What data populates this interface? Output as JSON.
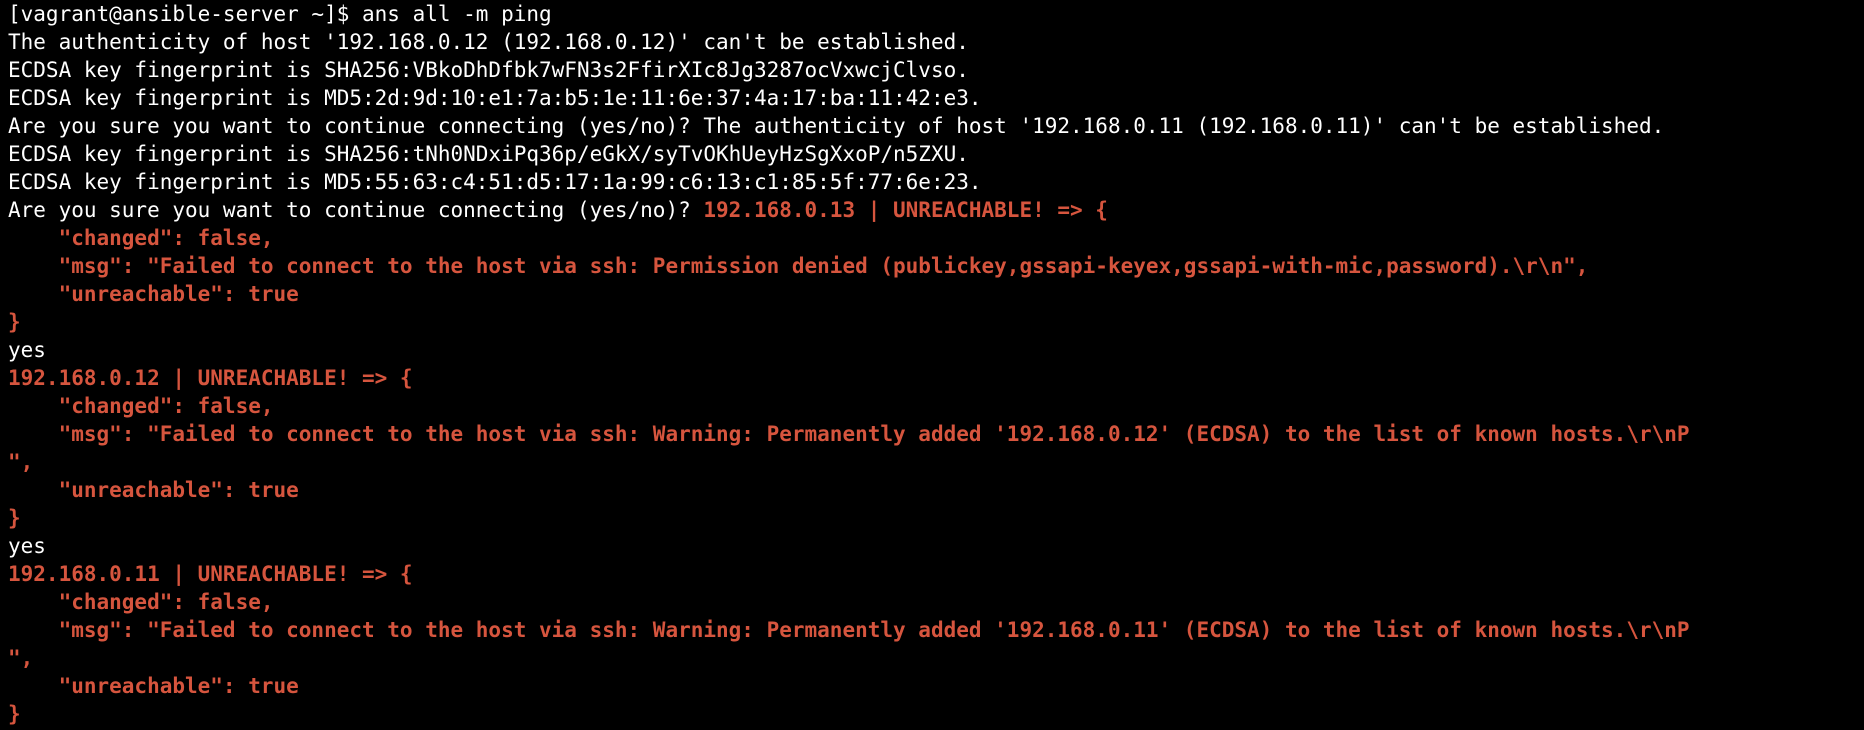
{
  "colors": {
    "background": "#000000",
    "default_text": "#ffffff",
    "error_text": "#d6553e"
  },
  "lines": [
    {
      "segments": [
        {
          "text": "[vagrant@ansible-server ~]$ ans all -m ping",
          "style": "w"
        }
      ]
    },
    {
      "segments": [
        {
          "text": "The authenticity of host '192.168.0.12 (192.168.0.12)' can't be established.",
          "style": "w"
        }
      ]
    },
    {
      "segments": [
        {
          "text": "ECDSA key fingerprint is SHA256:VBkoDhDfbk7wFN3s2FfirXIc8Jg3287ocVxwcjClvso.",
          "style": "w"
        }
      ]
    },
    {
      "segments": [
        {
          "text": "ECDSA key fingerprint is MD5:2d:9d:10:e1:7a:b5:1e:11:6e:37:4a:17:ba:11:42:e3.",
          "style": "w"
        }
      ]
    },
    {
      "segments": [
        {
          "text": "Are you sure you want to continue connecting (yes/no)? The authenticity of host '192.168.0.11 (192.168.0.11)' can't be established.",
          "style": "w"
        }
      ]
    },
    {
      "segments": [
        {
          "text": "ECDSA key fingerprint is SHA256:tNh0NDxiPq36p/eGkX/syTvOKhUeyHzSgXxoP/n5ZXU.",
          "style": "w"
        }
      ]
    },
    {
      "segments": [
        {
          "text": "ECDSA key fingerprint is MD5:55:63:c4:51:d5:17:1a:99:c6:13:c1:85:5f:77:6e:23.",
          "style": "w"
        }
      ]
    },
    {
      "segments": [
        {
          "text": "Are you sure you want to continue connecting (yes/no)? ",
          "style": "w"
        },
        {
          "text": "192.168.0.13 | UNREACHABLE! => {",
          "style": "err"
        }
      ]
    },
    {
      "segments": [
        {
          "text": "    \"changed\": false,",
          "style": "err"
        }
      ]
    },
    {
      "segments": [
        {
          "text": "    \"msg\": \"Failed to connect to the host via ssh: Permission denied (publickey,gssapi-keyex,gssapi-with-mic,password).\\r\\n\",",
          "style": "err"
        }
      ]
    },
    {
      "segments": [
        {
          "text": "    \"unreachable\": true",
          "style": "err"
        }
      ]
    },
    {
      "segments": [
        {
          "text": "}",
          "style": "err"
        }
      ]
    },
    {
      "segments": [
        {
          "text": "yes",
          "style": "w"
        }
      ]
    },
    {
      "segments": [
        {
          "text": "192.168.0.12 | UNREACHABLE! => {",
          "style": "err"
        }
      ]
    },
    {
      "segments": [
        {
          "text": "    \"changed\": false,",
          "style": "err"
        }
      ]
    },
    {
      "segments": [
        {
          "text": "    \"msg\": \"Failed to connect to the host via ssh: Warning: Permanently added '192.168.0.12' (ECDSA) to the list of known hosts.\\r\\nP",
          "style": "err"
        }
      ]
    },
    {
      "segments": [
        {
          "text": "\",",
          "style": "err"
        }
      ]
    },
    {
      "segments": [
        {
          "text": "    \"unreachable\": true",
          "style": "err"
        }
      ]
    },
    {
      "segments": [
        {
          "text": "}",
          "style": "err"
        }
      ]
    },
    {
      "segments": [
        {
          "text": "yes",
          "style": "w"
        }
      ]
    },
    {
      "segments": [
        {
          "text": "192.168.0.11 | UNREACHABLE! => {",
          "style": "err"
        }
      ]
    },
    {
      "segments": [
        {
          "text": "    \"changed\": false,",
          "style": "err"
        }
      ]
    },
    {
      "segments": [
        {
          "text": "    \"msg\": \"Failed to connect to the host via ssh: Warning: Permanently added '192.168.0.11' (ECDSA) to the list of known hosts.\\r\\nP",
          "style": "err"
        }
      ]
    },
    {
      "segments": [
        {
          "text": "\",",
          "style": "err"
        }
      ]
    },
    {
      "segments": [
        {
          "text": "    \"unreachable\": true",
          "style": "err"
        }
      ]
    },
    {
      "segments": [
        {
          "text": "}",
          "style": "err"
        }
      ]
    }
  ]
}
